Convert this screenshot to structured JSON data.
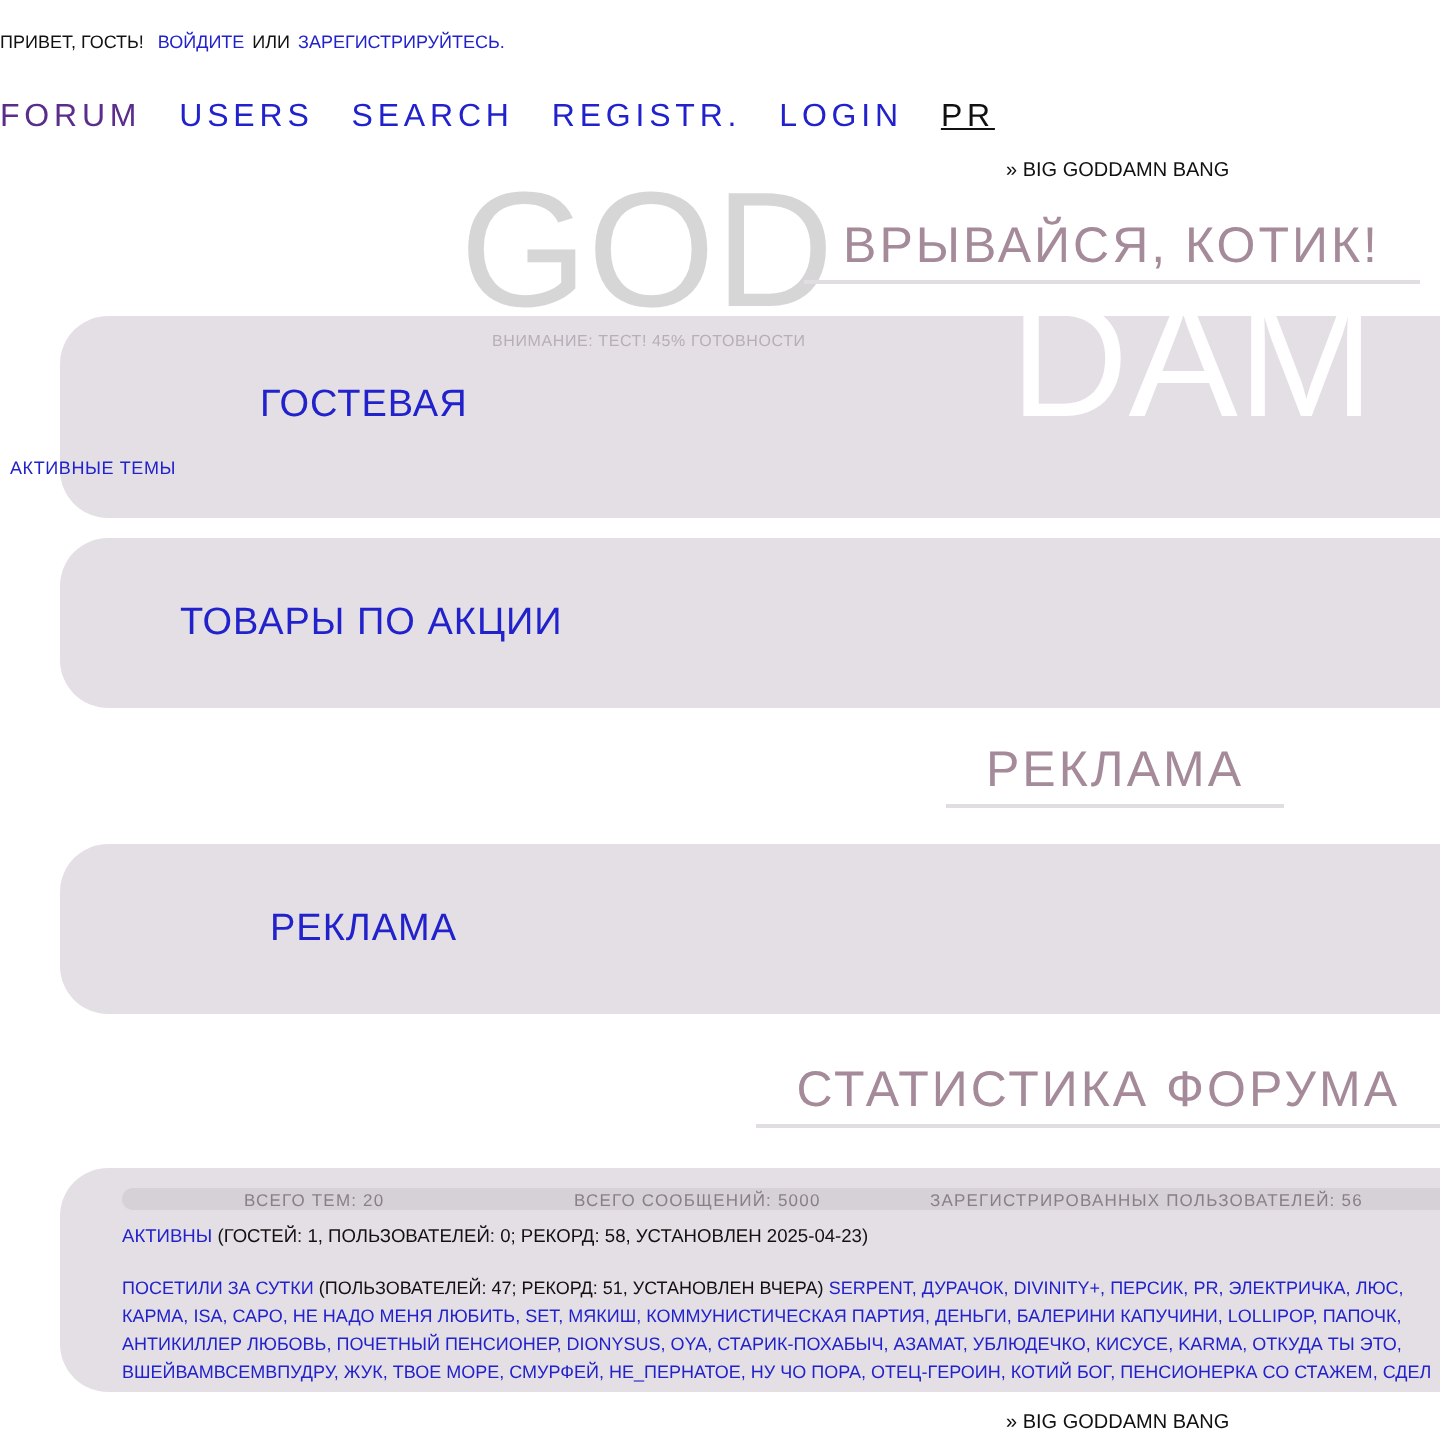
{
  "greeting": {
    "text": "ПРИВЕТ, ГОСТЬ!",
    "login": "ВОЙДИТЕ",
    "or": "ИЛИ",
    "register": "ЗАРЕГИСТРИРУЙТЕСЬ."
  },
  "nav": [
    {
      "label": "FORUM",
      "visited": true,
      "selected": false
    },
    {
      "label": "USERS",
      "visited": false,
      "selected": false
    },
    {
      "label": "SEARCH",
      "visited": false,
      "selected": false
    },
    {
      "label": "REGISTR.",
      "visited": false,
      "selected": false
    },
    {
      "label": "LOGIN",
      "visited": false,
      "selected": false
    },
    {
      "label": "PR",
      "visited": false,
      "selected": true
    }
  ],
  "breadcrumb": "» BIG GODDAMN BANG",
  "banner": {
    "word_1": "GOD",
    "word_2": "DAM",
    "notice": "ВНИМАНИЕ: ТЕСТ! 45% ГОТОВНОСТИ"
  },
  "sections": [
    {
      "heading": "ВРЫВАЙСЯ, КОТИК!",
      "forums": [
        {
          "title": "ГОСТЕВАЯ",
          "side_link": "АКТИВНЫЕ ТЕМЫ"
        },
        {
          "title": "ТОВАРЫ ПО АКЦИИ"
        }
      ]
    },
    {
      "heading": "РЕКЛАМА",
      "forums": [
        {
          "title": "РЕКЛАМА"
        }
      ]
    }
  ],
  "stats": {
    "heading": "СТАТИСТИКА ФОРУМА",
    "counters": [
      "ВСЕГО ТЕМ: 20",
      "ВСЕГО СООБЩЕНИЙ: 5000",
      "ЗАРЕГИСТРИРОВАННЫХ ПОЛЬЗОВАТЕЛЕЙ: 56"
    ],
    "active_label": "АКТИВНЫ",
    "active_info": "(ГОСТЕЙ: 1, ПОЛЬЗОВАТЕЛЕЙ: 0; РЕКОРД: 58, УСТАНОВЛЕН 2025-04-23)",
    "separator": ",",
    "visited_label": "ПОСЕТИЛИ ЗА СУТКИ",
    "visited_info": "(ПОЛЬЗОВАТЕЛЕЙ: 47; РЕКОРД: 51, УСТАНОВЛЕН ВЧЕРА)",
    "users": [
      "SERPENT",
      "ДУРАЧОК",
      "DIVINITY+",
      "ПЕРСИК",
      "PR",
      "ЭЛЕКТРИЧКА",
      "ЛЮС",
      "КАРМА",
      "ISA",
      "САРО",
      "НЕ НАДО МЕНЯ ЛЮБИТЬ",
      "SET",
      "МЯКИШ",
      "КОММУНИСТИЧЕСКАЯ ПАРТИЯ",
      "ДЕНЬГИ",
      "БАЛЕРИНИ КАПУЧИНИ",
      "LOLLIPOP",
      "ПАПОЧК",
      "АНТИКИЛЛЕР ЛЮБОВЬ",
      "ПОЧЕТНЫЙ ПЕНСИОНЕР",
      "DIONYSUS",
      "OYA",
      "СТАРИК-ПОХАБЫЧ",
      "АЗАМАТ",
      "УБЛЮДЕЧКО",
      "КИСУСЕ",
      "KARMA",
      "ОТКУДА ТЫ ЭТО",
      "ВШЕЙВАМВСЕМВПУДРУ",
      "ЖУК",
      "ТВОЕ МОРЕ",
      "СМУРФЕЙ",
      "НЕ_ПЕРНАТОЕ",
      "НУ ЧО ПОРА",
      "ОТЕЦ-ГЕРОИН",
      "КОТИЙ БОГ",
      "ПЕНСИОНЕРКА СО СТАЖЕМ",
      "СДЕЛ"
    ]
  },
  "footer_breadcrumb": "» BIG GODDAMN BANG"
}
